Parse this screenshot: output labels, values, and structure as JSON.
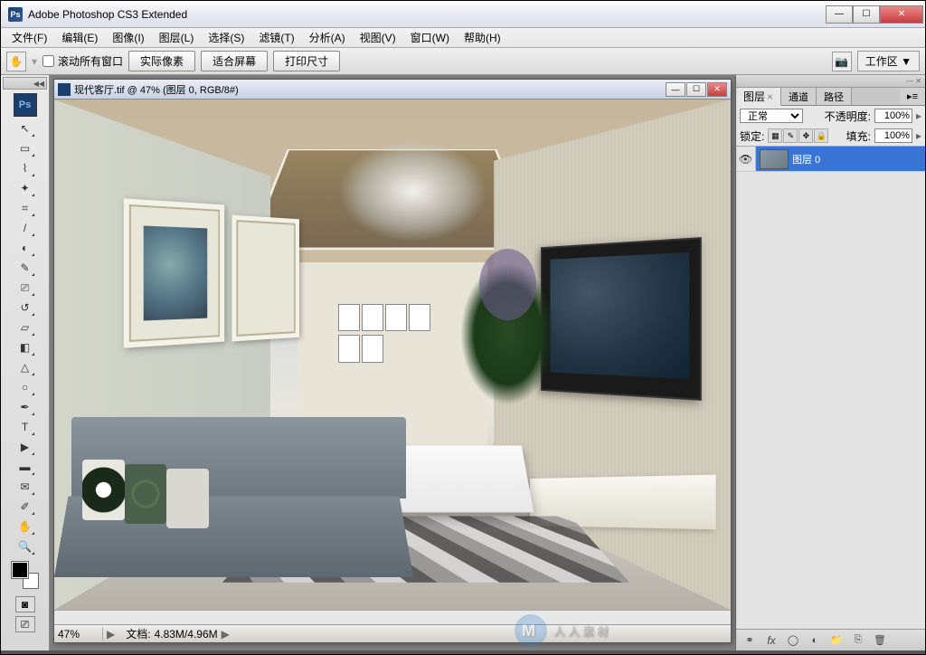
{
  "titlebar": {
    "app_icon": "Ps",
    "title": "Adobe Photoshop CS3 Extended"
  },
  "menubar": [
    "文件(F)",
    "编辑(E)",
    "图像(I)",
    "图层(L)",
    "选择(S)",
    "滤镜(T)",
    "分析(A)",
    "视图(V)",
    "窗口(W)",
    "帮助(H)"
  ],
  "optionbar": {
    "scroll_all": "滚动所有窗口",
    "btn1": "实际像素",
    "btn2": "适合屏幕",
    "btn3": "打印尺寸",
    "workspace": "工作区 ▼"
  },
  "tools": [
    {
      "name": "move-tool",
      "glyph": "↖"
    },
    {
      "name": "marquee-tool",
      "glyph": "▭"
    },
    {
      "name": "lasso-tool",
      "glyph": "⌇"
    },
    {
      "name": "wand-tool",
      "glyph": "✦"
    },
    {
      "name": "crop-tool",
      "glyph": "⌗"
    },
    {
      "name": "slice-tool",
      "glyph": "/"
    },
    {
      "name": "heal-tool",
      "glyph": "◐"
    },
    {
      "name": "brush-tool",
      "glyph": "✎"
    },
    {
      "name": "stamp-tool",
      "glyph": "⎚"
    },
    {
      "name": "history-brush-tool",
      "glyph": "↺"
    },
    {
      "name": "eraser-tool",
      "glyph": "▱"
    },
    {
      "name": "gradient-tool",
      "glyph": "◧"
    },
    {
      "name": "blur-tool",
      "glyph": "△"
    },
    {
      "name": "dodge-tool",
      "glyph": "○"
    },
    {
      "name": "pen-tool",
      "glyph": "✒"
    },
    {
      "name": "type-tool",
      "glyph": "T"
    },
    {
      "name": "path-select-tool",
      "glyph": "▶"
    },
    {
      "name": "shape-tool",
      "glyph": "▬"
    },
    {
      "name": "notes-tool",
      "glyph": "✉"
    },
    {
      "name": "eyedropper-tool",
      "glyph": "✐"
    },
    {
      "name": "hand-tool",
      "glyph": "✋"
    },
    {
      "name": "zoom-tool",
      "glyph": "🔍"
    }
  ],
  "document": {
    "title": "现代客厅.tif @ 47% (图层 0, RGB/8#)",
    "zoom": "47%",
    "info_label": "文档:",
    "info": "4.83M/4.96M"
  },
  "layers_panel": {
    "tabs": [
      "图层",
      "通道",
      "路径"
    ],
    "blend_mode": "正常",
    "opacity_label": "不透明度:",
    "opacity": "100%",
    "lock_label": "锁定:",
    "fill_label": "填充:",
    "fill": "100%",
    "layer0": "图层 0"
  },
  "watermark": "人人素材"
}
